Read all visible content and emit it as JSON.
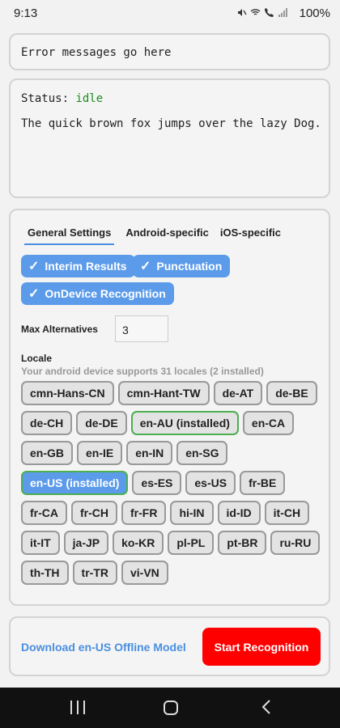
{
  "status_bar": {
    "time": "9:13",
    "battery": "100%"
  },
  "error_box": {
    "text": "Error messages go here"
  },
  "status_box": {
    "label": "Status:",
    "value": "idle",
    "transcript": "The quick brown fox jumps over the lazy Dog."
  },
  "settings": {
    "tabs": [
      {
        "label": "General Settings",
        "active": true
      },
      {
        "label": "Android-specific"
      },
      {
        "label": "iOS-specific"
      }
    ],
    "toggles": [
      {
        "label": "Interim Results",
        "checked": true
      },
      {
        "label": "Punctuation",
        "checked": true
      },
      {
        "label": "OnDevice Recognition",
        "checked": true
      }
    ],
    "max_alternatives": {
      "label": "Max Alternatives",
      "value": "3"
    },
    "locale": {
      "label": "Locale",
      "subtitle": "Your android device supports 31 locales (2 installed)",
      "items": [
        [
          "cmn-Hans-CN",
          "cmn-Hant-TW",
          "de-AT",
          "de-BE"
        ],
        [
          "de-CH",
          "de-DE",
          "en-AU (installed)",
          "en-CA"
        ],
        [
          "en-GB",
          "en-IE",
          "en-IN",
          "en-SG"
        ],
        [
          "en-US (installed)",
          "es-ES",
          "es-US",
          "fr-BE"
        ],
        [
          "fr-CA",
          "fr-CH",
          "fr-FR",
          "hi-IN",
          "id-ID",
          "it-CH"
        ],
        [
          "it-IT",
          "ja-JP",
          "ko-KR",
          "pl-PL",
          "pt-BR",
          "ru-RU"
        ],
        [
          "th-TH",
          "tr-TR",
          "vi-VN"
        ]
      ],
      "installed": [
        "en-AU (installed)",
        "en-US (installed)"
      ],
      "selected": "en-US (installed)"
    }
  },
  "actions": {
    "download_label": "Download en-US Offline Model",
    "start_label": "Start Recognition"
  },
  "colors": {
    "accent": "#5b9bea",
    "start": "#ff0000",
    "installed_border": "#4caf50",
    "status_idle": "#1a8c1a"
  }
}
